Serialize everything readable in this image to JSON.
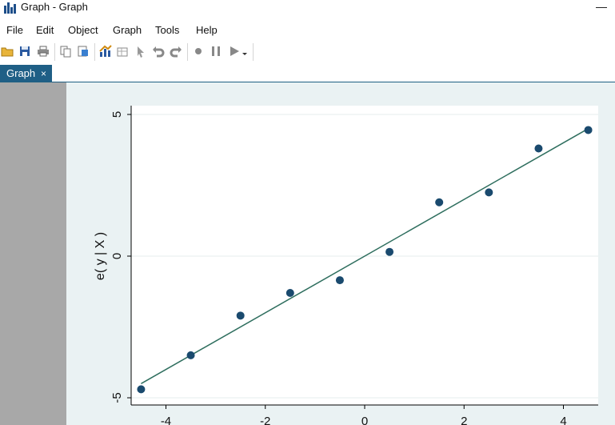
{
  "window": {
    "title": "Graph - Graph",
    "minimize": "—"
  },
  "menu": [
    "File",
    "Edit",
    "Object",
    "Graph",
    "Tools",
    "Help"
  ],
  "toolbar": {
    "icons": [
      "open-folder-icon",
      "save-icon",
      "print-icon",
      "copy-icon",
      "paste-icon",
      "graph-editor-icon",
      "data-editor-icon",
      "pointer-icon",
      "undo-icon",
      "redo-icon",
      "record-icon",
      "pause-icon",
      "play-icon",
      "dropdown-arrow-icon"
    ]
  },
  "tabs": [
    {
      "label": "Graph",
      "close": "×"
    }
  ],
  "colors": {
    "accent": "#1f5f86",
    "marker": "#1a4a6e",
    "fit_line": "#2e6e5e",
    "plot_bg": "#ffffff",
    "outer_bg": "#eaf2f3",
    "sidebar": "#a8a8a8"
  },
  "chart_data": {
    "type": "scatter",
    "title": "",
    "xlabel": "",
    "ylabel": "e( y | X )",
    "xlim": [
      -4.7,
      4.7
    ],
    "ylim": [
      -5,
      5
    ],
    "yticks": [
      "5",
      "0",
      "-5"
    ],
    "xticks": [
      "-4",
      "-2",
      "0",
      "2",
      "4"
    ],
    "grid": "horizontal",
    "series": [
      {
        "points": [
          {
            "x": -4.5,
            "y": -4.7
          },
          {
            "x": -3.5,
            "y": -3.5
          },
          {
            "x": -2.5,
            "y": -2.1
          },
          {
            "x": -1.5,
            "y": -1.3
          },
          {
            "x": -0.5,
            "y": -0.85
          },
          {
            "x": 0.5,
            "y": 0.15
          },
          {
            "x": 1.5,
            "y": 1.9
          },
          {
            "x": 2.5,
            "y": 2.25
          },
          {
            "x": 3.5,
            "y": 3.8
          },
          {
            "x": 4.5,
            "y": 4.45
          }
        ]
      }
    ],
    "fit_line": {
      "slope": 1.0,
      "intercept": 0.0
    }
  }
}
